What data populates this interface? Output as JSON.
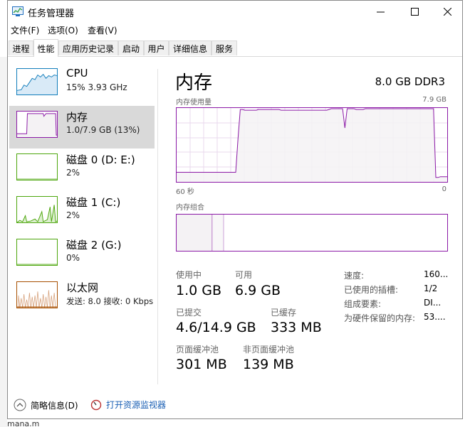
{
  "window": {
    "title": "任务管理器"
  },
  "menu": [
    "文件(F)",
    "选项(O)",
    "查看(V)"
  ],
  "tabs": [
    {
      "label": "进程"
    },
    {
      "label": "性能",
      "active": true
    },
    {
      "label": "应用历史记录"
    },
    {
      "label": "启动"
    },
    {
      "label": "用户"
    },
    {
      "label": "详细信息"
    },
    {
      "label": "服务"
    }
  ],
  "sidebar": [
    {
      "name": "CPU",
      "value": "15% 3.93 GHz",
      "color": "#117dbb"
    },
    {
      "name": "内存",
      "value": "1.0/7.9 GB (13%)",
      "color": "#8b19a6",
      "selected": true
    },
    {
      "name": "磁盘 0 (D: E:)",
      "value": "2%",
      "color": "#4da60c"
    },
    {
      "name": "磁盘 1 (C:)",
      "value": "2%",
      "color": "#4da60c"
    },
    {
      "name": "磁盘 2 (G:)",
      "value": "0%",
      "color": "#4da60c"
    },
    {
      "name": "以太网",
      "value": "发送: 8.0  接收: 0 Kbps",
      "color": "#a74f01"
    }
  ],
  "main": {
    "title": "内存",
    "spec": "8.0 GB DDR3",
    "usage_label": "内存使用量",
    "usage_max": "7.9 GB",
    "time_left": "60 秒",
    "time_right": "0",
    "composition_label": "内存组合",
    "usage_history_percent": [
      0.13,
      0.13,
      0.13,
      0.13,
      0.13,
      0.13,
      0.13,
      0.13,
      0.13,
      0.13,
      0.13,
      0.13,
      0.13,
      0.13,
      0.13,
      0.13,
      0.13,
      0.13,
      0.13,
      0.13,
      0.13,
      0.13,
      0.13,
      0.13,
      0.13,
      0.13,
      0.13,
      0.58,
      0.98,
      0.98,
      0.97,
      0.97,
      0.97,
      0.97,
      0.97,
      0.97,
      0.98,
      0.98,
      0.98,
      0.98,
      0.98,
      0.98,
      0.98,
      0.98,
      0.98,
      0.98,
      0.97,
      0.97,
      0.97,
      0.97,
      0.97,
      0.97,
      0.97,
      0.97,
      0.97,
      0.97,
      0.97,
      0.97,
      0.97,
      0.97,
      0.97,
      0.97,
      0.97,
      0.97,
      0.97,
      0.97,
      0.97,
      0.98,
      0.99,
      0.99,
      0.99,
      0.99,
      0.99,
      0.99,
      0.73,
      0.99,
      0.99,
      0.99,
      0.99,
      0.98,
      0.98,
      0.98,
      0.98,
      0.99,
      0.99,
      0.99,
      0.99,
      0.99,
      0.99,
      0.99,
      0.99,
      0.99,
      0.99,
      0.99,
      0.99,
      0.99,
      0.99,
      0.99,
      0.99,
      0.99,
      0.99,
      0.99,
      0.99,
      0.99,
      0.99,
      0.99,
      0.99,
      0.99,
      0.99,
      0.99,
      0.99,
      0.99,
      0.99,
      0.99,
      0.06,
      0.06,
      0.07,
      0.07,
      0.07,
      0.07
    ],
    "stats": [
      {
        "label": "使用中",
        "value": "1.0 GB"
      },
      {
        "label": "可用",
        "value": "6.9 GB"
      },
      {
        "label": "已提交",
        "value": "4.6/14.9 GB"
      },
      {
        "label": "已缓存",
        "value": "333 MB"
      },
      {
        "label": "页面缓冲池",
        "value": "301 MB"
      },
      {
        "label": "非页面缓冲池",
        "value": "139 MB"
      }
    ],
    "details": [
      {
        "label": "速度:",
        "value": "160..."
      },
      {
        "label": "已使用的插槽:",
        "value": "1/2"
      },
      {
        "label": "组成要素:",
        "value": "DI..."
      },
      {
        "label": "为硬件保留的内存:",
        "value": "53...."
      }
    ]
  },
  "footer": {
    "brief": "简略信息(D)",
    "monitor": "打开资源监视器"
  },
  "behind_text": "mana.m",
  "colors": {
    "memory": "#8b19a6",
    "memory_fill": "#f4f2f4",
    "link": "#1a5fb4"
  }
}
